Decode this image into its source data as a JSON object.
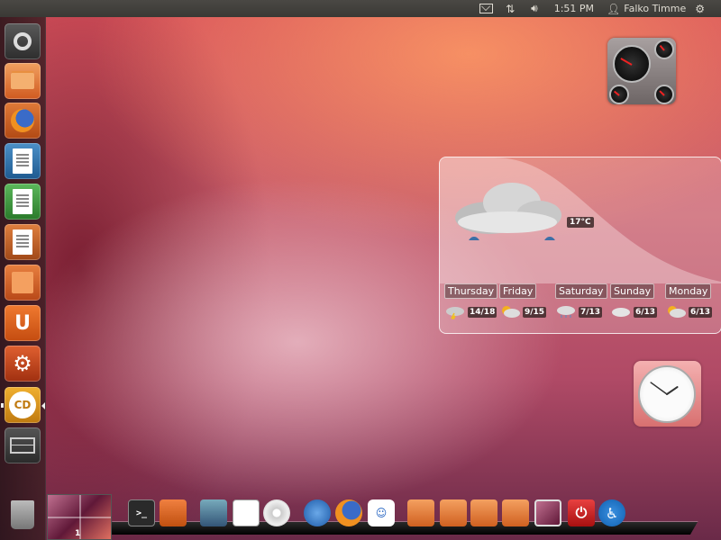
{
  "top_panel": {
    "time": "1:51 PM",
    "user_name": "Falko Timme",
    "icons": [
      "mail-icon",
      "network-icon",
      "volume-icon",
      "user-icon",
      "gear-icon"
    ]
  },
  "launcher": {
    "items": [
      {
        "name": "dash-home",
        "icon": "ubuntu-logo-icon"
      },
      {
        "name": "home-folder",
        "icon": "folder-icon"
      },
      {
        "name": "firefox",
        "icon": "firefox-icon"
      },
      {
        "name": "libreoffice-writer",
        "icon": "writer-icon"
      },
      {
        "name": "libreoffice-calc",
        "icon": "calc-icon"
      },
      {
        "name": "libreoffice-impress",
        "icon": "impress-icon"
      },
      {
        "name": "ubuntu-software-center",
        "icon": "store-icon"
      },
      {
        "name": "ubuntu-one",
        "icon": "ubuntu-one-icon",
        "glyph": "U"
      },
      {
        "name": "system-settings",
        "icon": "settings-icon",
        "glyph": "⚙"
      },
      {
        "name": "cairo-dock",
        "icon": "cairo-dock-icon",
        "glyph": "CD"
      },
      {
        "name": "workspace-switcher",
        "icon": "workspace-icon"
      },
      {
        "name": "trash",
        "icon": "trash-icon"
      }
    ]
  },
  "weather": {
    "current_temp": "17°C",
    "current_condition_icon": "rain-cloud-icon",
    "forecast": [
      {
        "day": "Thursday",
        "temp": "14/18",
        "icon": "thunderstorm-icon"
      },
      {
        "day": "Friday",
        "temp": "9/15",
        "icon": "sun-rain-icon"
      },
      {
        "day": "Saturday",
        "temp": "7/13",
        "icon": "rain-icon"
      },
      {
        "day": "Sunday",
        "temp": "6/13",
        "icon": "cloud-icon"
      },
      {
        "day": "Monday",
        "temp": "6/13",
        "icon": "sun-rain-icon"
      }
    ]
  },
  "clock": {
    "hour": 1,
    "minute": 51
  },
  "dock": {
    "workspace_number": "1",
    "items": [
      {
        "name": "terminal",
        "icon": "terminal-icon",
        "glyph": ">_"
      },
      {
        "name": "software-center",
        "icon": "store-icon"
      },
      {
        "name": "system-monitor",
        "icon": "monitor-icon"
      },
      {
        "name": "writer",
        "icon": "writer-icon"
      },
      {
        "name": "disc",
        "icon": "disc-icon"
      },
      {
        "name": "thunderbird",
        "icon": "thunderbird-icon"
      },
      {
        "name": "firefox",
        "icon": "firefox-icon"
      },
      {
        "name": "empathy",
        "icon": "chat-icon",
        "glyph": "☺"
      },
      {
        "name": "home-folder",
        "icon": "home-folder-icon"
      },
      {
        "name": "documents-folder",
        "icon": "documents-folder-icon"
      },
      {
        "name": "recent-folder",
        "icon": "recent-folder-icon"
      },
      {
        "name": "downloads-folder",
        "icon": "downloads-folder-icon"
      },
      {
        "name": "show-desktop",
        "icon": "screen-icon"
      },
      {
        "name": "shutdown",
        "icon": "power-icon",
        "glyph": "⏻"
      },
      {
        "name": "accessibility",
        "icon": "accessibility-icon",
        "glyph": "♿"
      }
    ]
  }
}
